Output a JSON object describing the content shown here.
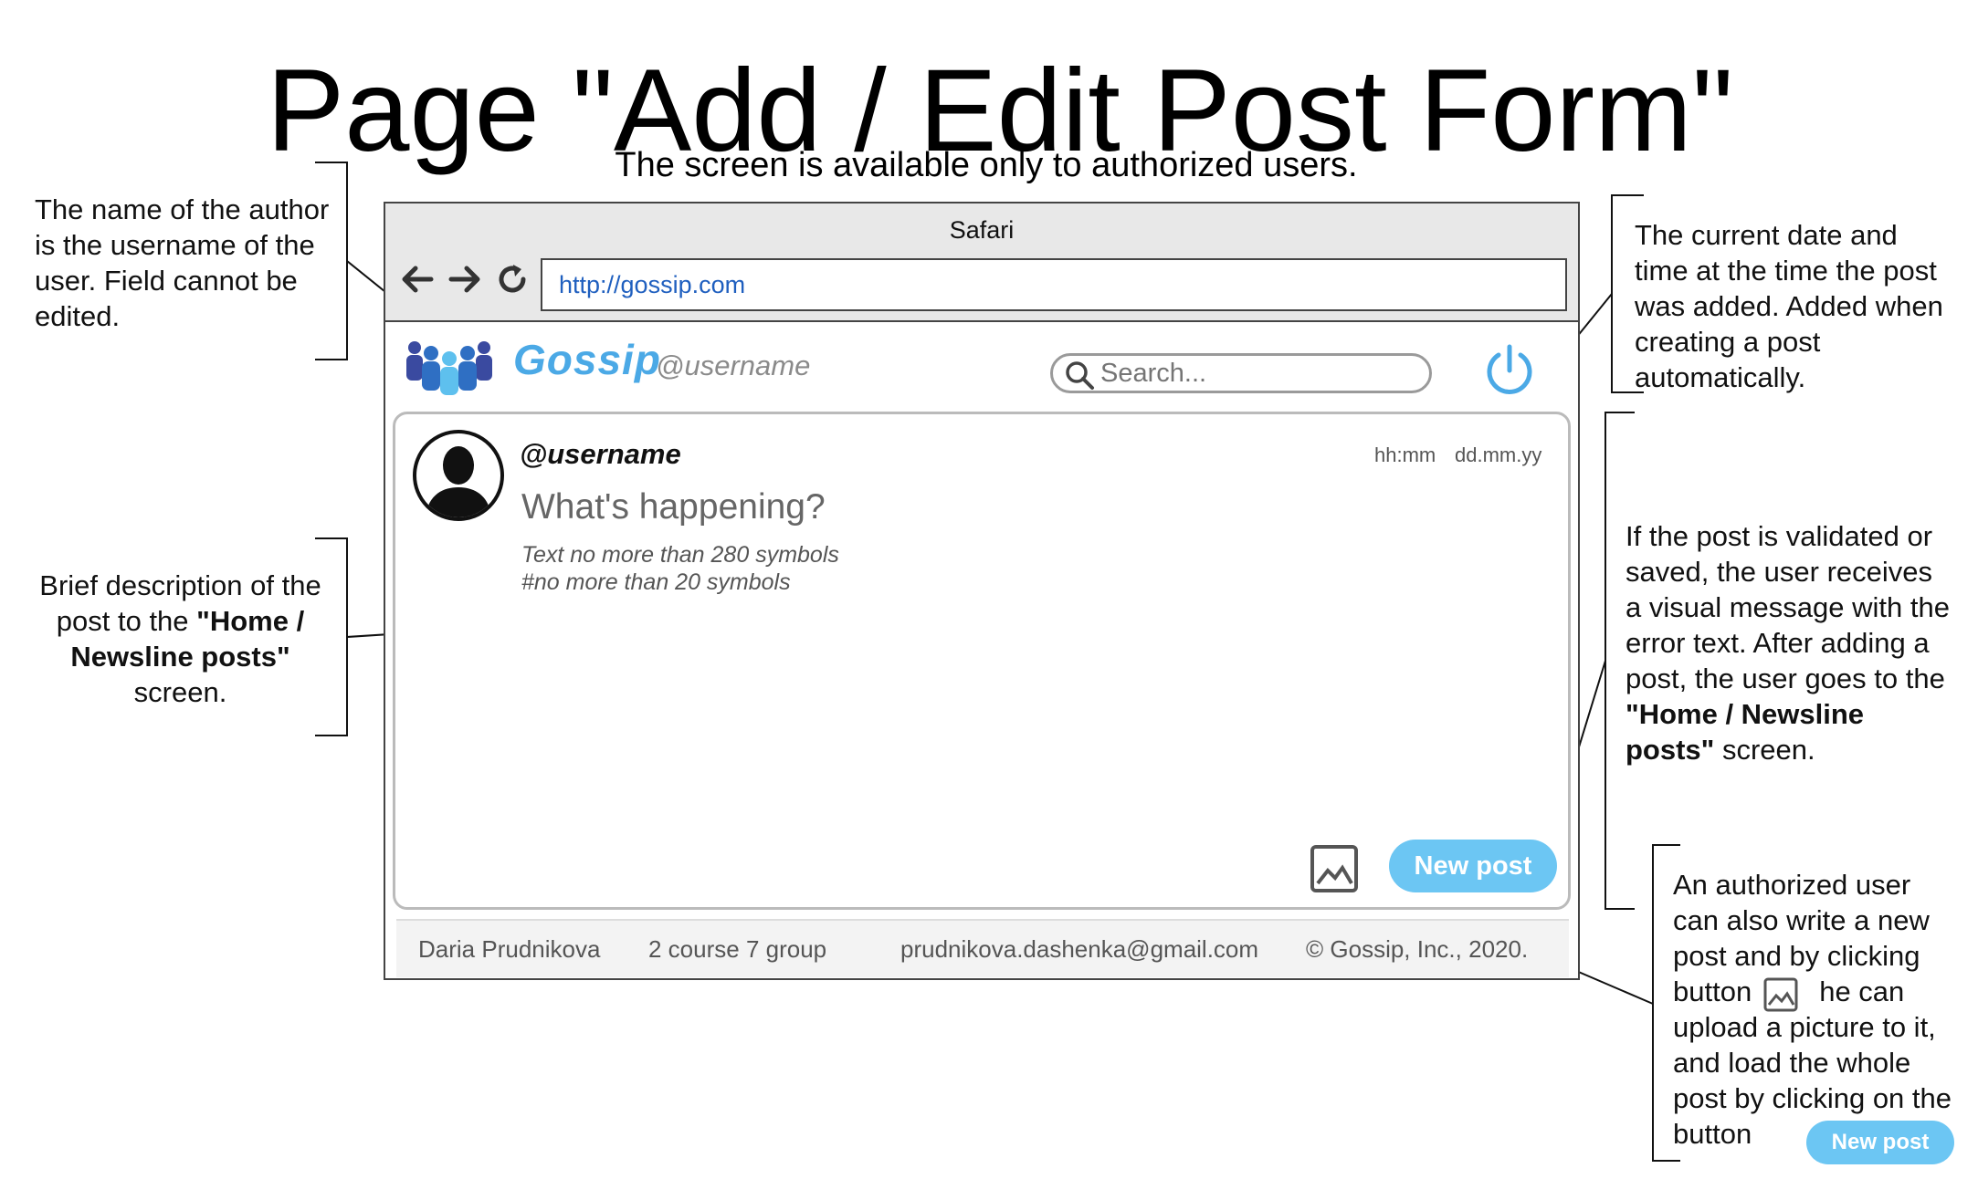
{
  "page": {
    "title": "Page \"Add / Edit Post Form\"",
    "subtitle": "The screen is available only to authorized users."
  },
  "notes": {
    "author": "The name of the author is the username of the user. Field cannot be edited.",
    "description_pre": "Brief description of the post to the ",
    "description_bold": "\"Home / Newsline posts\"",
    "description_post": " screen.",
    "datetime": "The current date and time at the time the post was added. Added when creating a post automatically.",
    "validation_pre": "If the post is validated or saved, the user receives a visual message with the error text. After adding a post, the user goes to the ",
    "validation_bold": "\"Home / Newsline posts\"",
    "validation_post": " screen.",
    "upload_part1": "An authorized user can also write a new post and by clicking button",
    "upload_part2": "he can upload a picture to it, and load the whole post by clicking on the button",
    "upload_button_label": "New post"
  },
  "browser": {
    "window_title": "Safari",
    "url": "http://gossip.com"
  },
  "app": {
    "brand": "Gossip",
    "handle": "@username",
    "search_placeholder": "Search...",
    "icons": [
      "people-logo-icon",
      "search-icon",
      "power-icon",
      "avatar-icon",
      "image-icon",
      "back-arrow-icon",
      "forward-arrow-icon",
      "reload-icon"
    ],
    "accent_color": "#6cc6f3",
    "brand_color": "#4ba9e6"
  },
  "post_form": {
    "username": "@username",
    "time": "hh:mm",
    "date": "dd.mm.yy",
    "prompt": "What's happening?",
    "hint_text": "Text no more than 280 symbols",
    "hint_tags": "#no more than 20 symbols",
    "submit_label": "New post"
  },
  "footer": {
    "name": "Daria Prudnikova",
    "group": "2 course 7 group",
    "email": "prudnikova.dashenka@gmail.com",
    "copyright": "© Gossip, Inc., 2020."
  }
}
